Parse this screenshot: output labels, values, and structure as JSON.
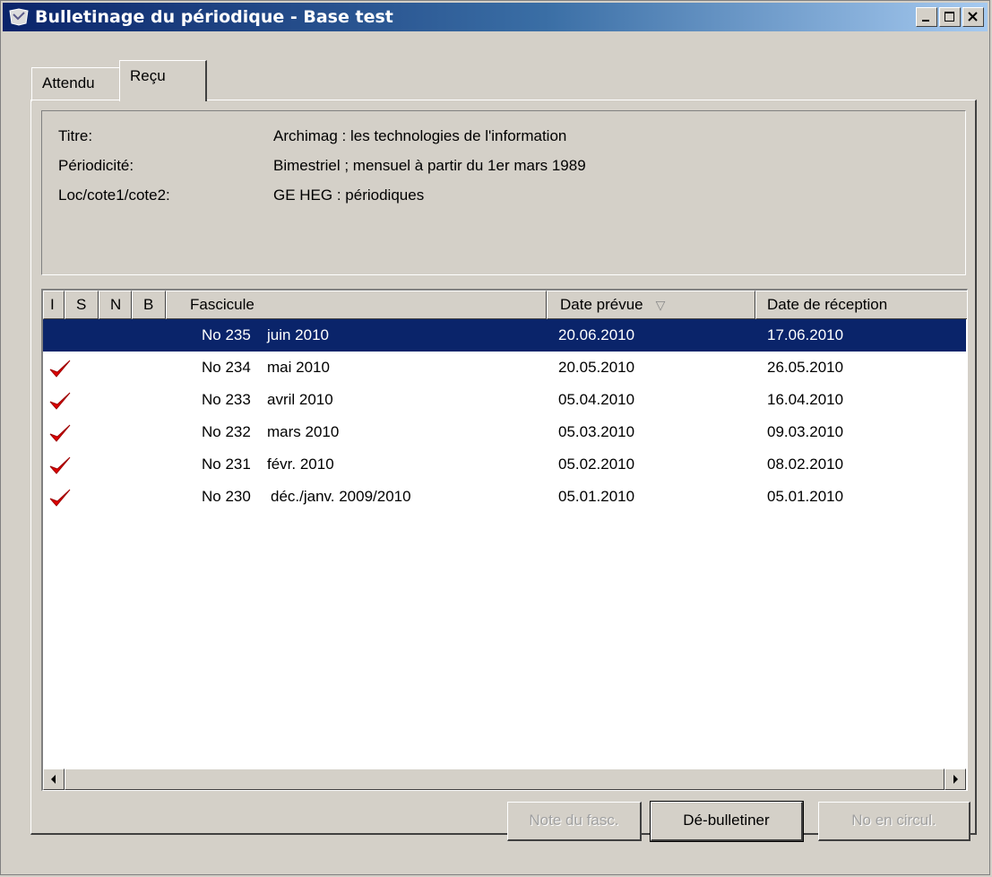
{
  "window": {
    "title": "Bulletinage du périodique - Base test"
  },
  "tabs": [
    {
      "label": "Attendu",
      "active": false
    },
    {
      "label": "Reçu",
      "active": true
    }
  ],
  "info": {
    "titre_label": "Titre:",
    "titre_value": "Archimag : les technologies de l'information",
    "periodicite_label": "Périodicité:",
    "periodicite_value": "Bimestriel ; mensuel à partir du 1er mars 1989",
    "loc_label": "Loc/cote1/cote2:",
    "loc_value": "GE HEG : périodiques"
  },
  "list": {
    "columns": [
      "I",
      "S",
      "N",
      "B",
      "Fascicule",
      "Date prévue",
      "Date de réception"
    ],
    "sort_indicator": "▽",
    "rows": [
      {
        "checked": false,
        "numero": "No 235",
        "periode": "juin 2010",
        "date_prevue": "20.06.2010",
        "date_reception": "17.06.2010",
        "selected": true
      },
      {
        "checked": true,
        "numero": "No 234",
        "periode": "mai 2010",
        "date_prevue": "20.05.2010",
        "date_reception": "26.05.2010",
        "selected": false
      },
      {
        "checked": true,
        "numero": "No 233",
        "periode": "avril 2010",
        "date_prevue": "05.04.2010",
        "date_reception": "16.04.2010",
        "selected": false
      },
      {
        "checked": true,
        "numero": "No 232",
        "periode": "mars 2010",
        "date_prevue": "05.03.2010",
        "date_reception": "09.03.2010",
        "selected": false
      },
      {
        "checked": true,
        "numero": "No 231",
        "periode": "févr. 2010",
        "date_prevue": "05.02.2010",
        "date_reception": "08.02.2010",
        "selected": false
      },
      {
        "checked": true,
        "numero": "No 230",
        "periode": "déc./janv. 2009/2010",
        "date_prevue": "05.01.2010",
        "date_reception": "05.01.2010",
        "selected": false
      }
    ]
  },
  "buttons": {
    "note_label": "Note du fasc.",
    "debulletiner_label": "Dé-bulletiner",
    "circul_label": "No en circul."
  },
  "colors": {
    "selection": "#0a246a",
    "check": "#e00000"
  },
  "icons": {
    "app": "periodical-app-icon",
    "check": "checkmark-icon"
  }
}
